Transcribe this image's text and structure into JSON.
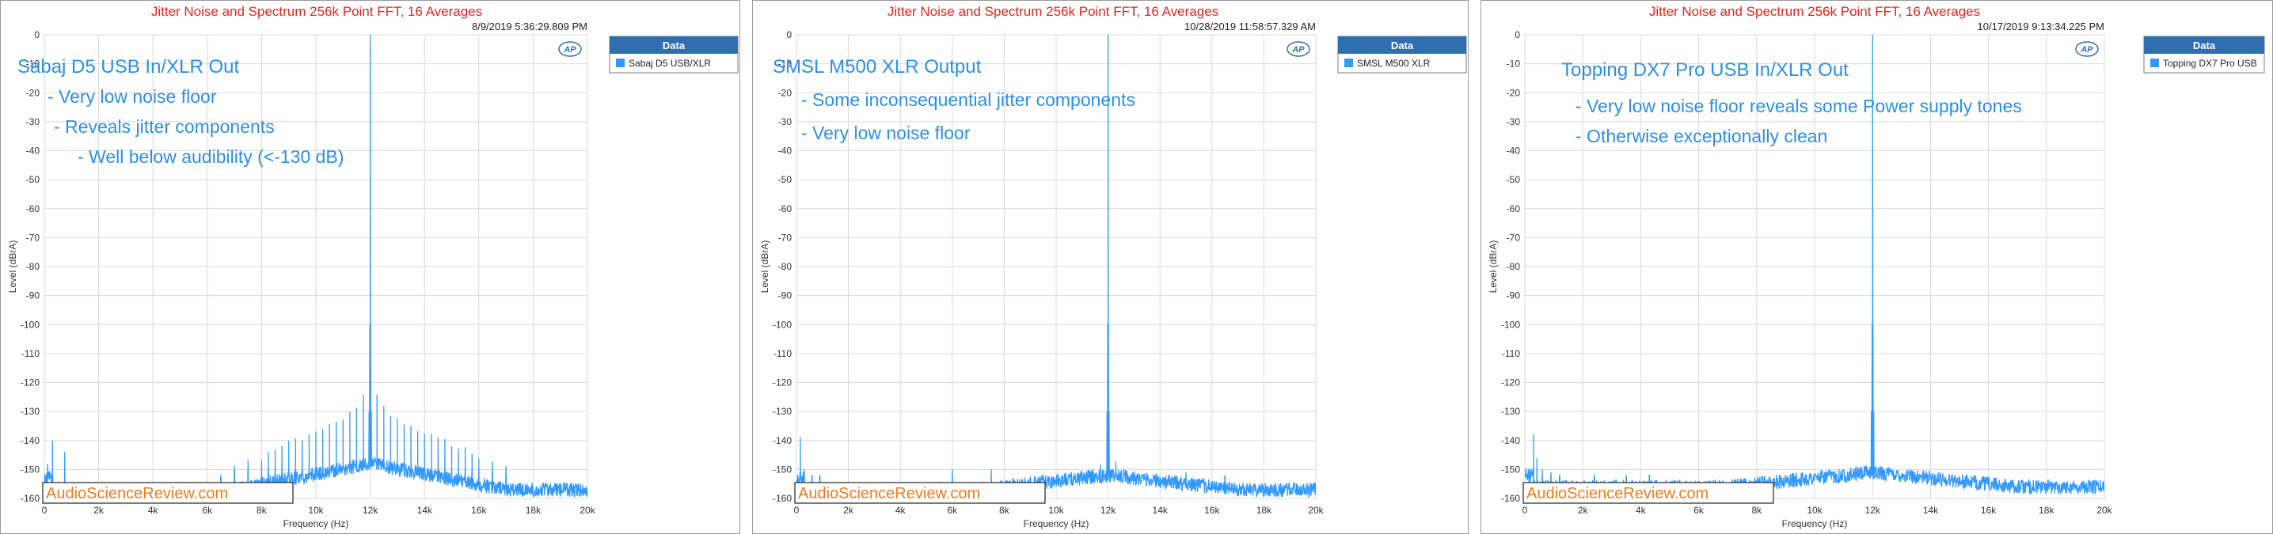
{
  "colors": {
    "title": "#e8231a",
    "trace": "#3399ff",
    "annotation": "#2b8fe8",
    "legend_header_bg": "#2f6fb0",
    "legend_header_text": "#ffffff",
    "watermark": "#f07a1e",
    "grid": "#d9d9d9",
    "axis": "#555555",
    "panel_border": "#9a9a9a"
  },
  "icons": {
    "logo": "ap-logo"
  },
  "chart_data": [
    {
      "type": "line",
      "title": "Jitter Noise and Spectrum 256k Point FFT, 16 Averages",
      "timestamp": "8/9/2019 5:36:29.809 PM",
      "xlabel": "Frequency (Hz)",
      "ylabel": "Level (dBrA)",
      "xlim": [
        0,
        20000
      ],
      "ylim": [
        -160,
        0
      ],
      "x_ticks": [
        "0",
        "2k",
        "4k",
        "6k",
        "8k",
        "10k",
        "12k",
        "14k",
        "16k",
        "18k",
        "20k"
      ],
      "y_ticks": [
        "0",
        "-10",
        "-20",
        "-30",
        "-40",
        "-50",
        "-60",
        "-70",
        "-80",
        "-90",
        "-100",
        "-110",
        "-120",
        "-130",
        "-140",
        "-150",
        "-160"
      ],
      "grid": true,
      "legend": {
        "header": "Data",
        "placement": "outside-right",
        "entries": [
          "Sabaj D5 USB/XLR"
        ]
      },
      "annotations": [
        "Sabaj D5 USB In/XLR Out",
        "- Very low noise floor",
        "- Reveals jitter components",
        "- Well below audibility (<-130 dB)"
      ],
      "watermark": "AudioScienceReview.com",
      "series": [
        {
          "name": "Sabaj D5 USB/XLR",
          "fundamental_hz": 12000,
          "fundamental_db": 0,
          "noise_floor_db": -157,
          "noise_floor_db_near_fundamental": -148,
          "sidebands": [
            {
              "offset_hz": 250,
              "db": -124
            },
            {
              "offset_hz": 500,
              "db": -128
            },
            {
              "offset_hz": 750,
              "db": -131
            },
            {
              "offset_hz": 1000,
              "db": -133
            },
            {
              "offset_hz": 1250,
              "db": -134
            },
            {
              "offset_hz": 1500,
              "db": -135
            },
            {
              "offset_hz": 1750,
              "db": -136
            },
            {
              "offset_hz": 2000,
              "db": -137
            },
            {
              "offset_hz": 2250,
              "db": -138
            },
            {
              "offset_hz": 2500,
              "db": -139
            },
            {
              "offset_hz": 2750,
              "db": -140
            },
            {
              "offset_hz": 3000,
              "db": -141
            },
            {
              "offset_hz": 3250,
              "db": -142
            },
            {
              "offset_hz": 3500,
              "db": -143
            },
            {
              "offset_hz": 3750,
              "db": -145
            },
            {
              "offset_hz": 4000,
              "db": -146
            },
            {
              "offset_hz": 4500,
              "db": -147
            },
            {
              "offset_hz": 5000,
              "db": -148
            }
          ],
          "spurs": [
            {
              "hz": 120,
              "db": -148
            },
            {
              "hz": 300,
              "db": -140
            },
            {
              "hz": 750,
              "db": -144
            },
            {
              "hz": 6500,
              "db": -153
            }
          ]
        }
      ]
    },
    {
      "type": "line",
      "title": "Jitter Noise and Spectrum 256k Point FFT, 16 Averages",
      "timestamp": "10/28/2019 11:58:57.329 AM",
      "xlabel": "Frequency (Hz)",
      "ylabel": "Level (dBrA)",
      "xlim": [
        0,
        20000
      ],
      "ylim": [
        -160,
        0
      ],
      "x_ticks": [
        "0",
        "2k",
        "4k",
        "6k",
        "8k",
        "10k",
        "12k",
        "14k",
        "16k",
        "18k",
        "20k"
      ],
      "y_ticks": [
        "0",
        "-10",
        "-20",
        "-30",
        "-40",
        "-50",
        "-60",
        "-70",
        "-80",
        "-90",
        "-100",
        "-110",
        "-120",
        "-130",
        "-140",
        "-150",
        "-160"
      ],
      "grid": true,
      "legend": {
        "header": "Data",
        "placement": "outside-right",
        "entries": [
          "SMSL M500 XLR"
        ]
      },
      "annotations": [
        "SMSL M500 XLR Output",
        "- Some inconsequential jitter components",
        "- Very low noise floor"
      ],
      "watermark": "AudioScienceReview.com",
      "series": [
        {
          "name": "SMSL M500 XLR",
          "fundamental_hz": 12000,
          "fundamental_db": 0,
          "noise_floor_db": -157,
          "noise_floor_db_near_fundamental": -152,
          "sidebands": [
            {
              "offset_hz": 300,
              "db": -148
            },
            {
              "offset_hz": 600,
              "db": -152
            }
          ],
          "spurs": [
            {
              "hz": 150,
              "db": -139
            },
            {
              "hz": 300,
              "db": -150
            },
            {
              "hz": 600,
              "db": -152
            },
            {
              "hz": 900,
              "db": -153
            },
            {
              "hz": 6000,
              "db": -150
            },
            {
              "hz": 7500,
              "db": -150
            },
            {
              "hz": 9500,
              "db": -153
            },
            {
              "hz": 15000,
              "db": -151
            },
            {
              "hz": 16500,
              "db": -153
            }
          ]
        }
      ]
    },
    {
      "type": "line",
      "title": "Jitter Noise and Spectrum 256k Point FFT, 16 Averages",
      "timestamp": "10/17/2019 9:13:34.225 PM",
      "xlabel": "Frequency (Hz)",
      "ylabel": "Level (dBrA)",
      "xlim": [
        0,
        20000
      ],
      "ylim": [
        -160,
        0
      ],
      "x_ticks": [
        "0",
        "2k",
        "4k",
        "6k",
        "8k",
        "10k",
        "12k",
        "14k",
        "16k",
        "18k",
        "20k"
      ],
      "y_ticks": [
        "0",
        "-10",
        "-20",
        "-30",
        "-40",
        "-50",
        "-60",
        "-70",
        "-80",
        "-90",
        "-100",
        "-110",
        "-120",
        "-130",
        "-140",
        "-150",
        "-160"
      ],
      "grid": true,
      "legend": {
        "header": "Data",
        "placement": "outside-right",
        "entries": [
          "Topping DX7 Pro USB"
        ]
      },
      "annotations": [
        "Topping DX7 Pro USB In/XLR Out",
        "- Very low noise floor reveals some Power supply tones",
        "- Otherwise exceptionally clean"
      ],
      "watermark": "AudioScienceReview.com",
      "series": [
        {
          "name": "Topping DX7 Pro USB",
          "fundamental_hz": 12000,
          "fundamental_db": 0,
          "noise_floor_db": -156,
          "noise_floor_db_near_fundamental": -151,
          "sidebands": [
            {
              "offset_hz": 200,
              "db": -150
            },
            {
              "offset_hz": 400,
              "db": -152
            }
          ],
          "spurs": [
            {
              "hz": 120,
              "db": -150
            },
            {
              "hz": 300,
              "db": -138
            },
            {
              "hz": 420,
              "db": -146
            },
            {
              "hz": 600,
              "db": -150
            },
            {
              "hz": 900,
              "db": -151
            },
            {
              "hz": 1200,
              "db": -152
            },
            {
              "hz": 2400,
              "db": -152
            },
            {
              "hz": 3500,
              "db": -153
            },
            {
              "hz": 4300,
              "db": -152
            }
          ]
        }
      ]
    }
  ]
}
